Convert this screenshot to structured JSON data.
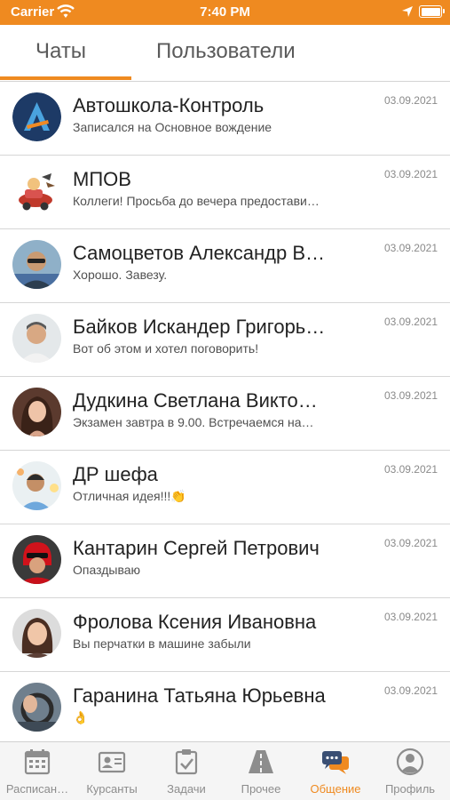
{
  "status_bar": {
    "carrier": "Carrier",
    "time": "7:40 PM"
  },
  "tabs": [
    {
      "label": "Чаты",
      "active": true
    },
    {
      "label": "Пользователи",
      "active": false
    }
  ],
  "chats": [
    {
      "name": "Автошкола-Контроль",
      "message": "Записался на Основное вождение",
      "date": "03.09.2021"
    },
    {
      "name": "МПОВ",
      "message": "Коллеги! Просьба до вечера предостави…",
      "date": "03.09.2021"
    },
    {
      "name": "Самоцветов Александр В…",
      "message": "Хорошо. Завезу.",
      "date": "03.09.2021"
    },
    {
      "name": "Байков Искандер Григорь…",
      "message": "Вот об этом и хотел поговорить!",
      "date": "03.09.2021"
    },
    {
      "name": "Дудкина Светлана Викто…",
      "message": "Экзамен завтра в 9.00. Встречаемся на…",
      "date": "03.09.2021"
    },
    {
      "name": "ДР шефа",
      "message": "Отличная идея!!!👏",
      "date": "03.09.2021"
    },
    {
      "name": "Кантарин Сергей Петрович",
      "message": "Опаздываю",
      "date": "03.09.2021"
    },
    {
      "name": "Фролова Ксения Ивановна",
      "message": "Вы перчатки в машине забыли",
      "date": "03.09.2021"
    },
    {
      "name": "Гаранина Татьяна Юрьевна",
      "message": "👌",
      "date": "03.09.2021"
    }
  ],
  "tab_bar": [
    {
      "label": "Расписан…",
      "icon": "calendar-icon"
    },
    {
      "label": "Курсанты",
      "icon": "id-card-icon"
    },
    {
      "label": "Задачи",
      "icon": "task-icon"
    },
    {
      "label": "Прочее",
      "icon": "road-icon"
    },
    {
      "label": "Общение",
      "icon": "chat-icon",
      "active": true
    },
    {
      "label": "Профиль",
      "icon": "profile-icon"
    }
  ],
  "colors": {
    "accent": "#ef8a20",
    "inactive": "#8d8d8d",
    "divider": "#d6d6d6"
  }
}
